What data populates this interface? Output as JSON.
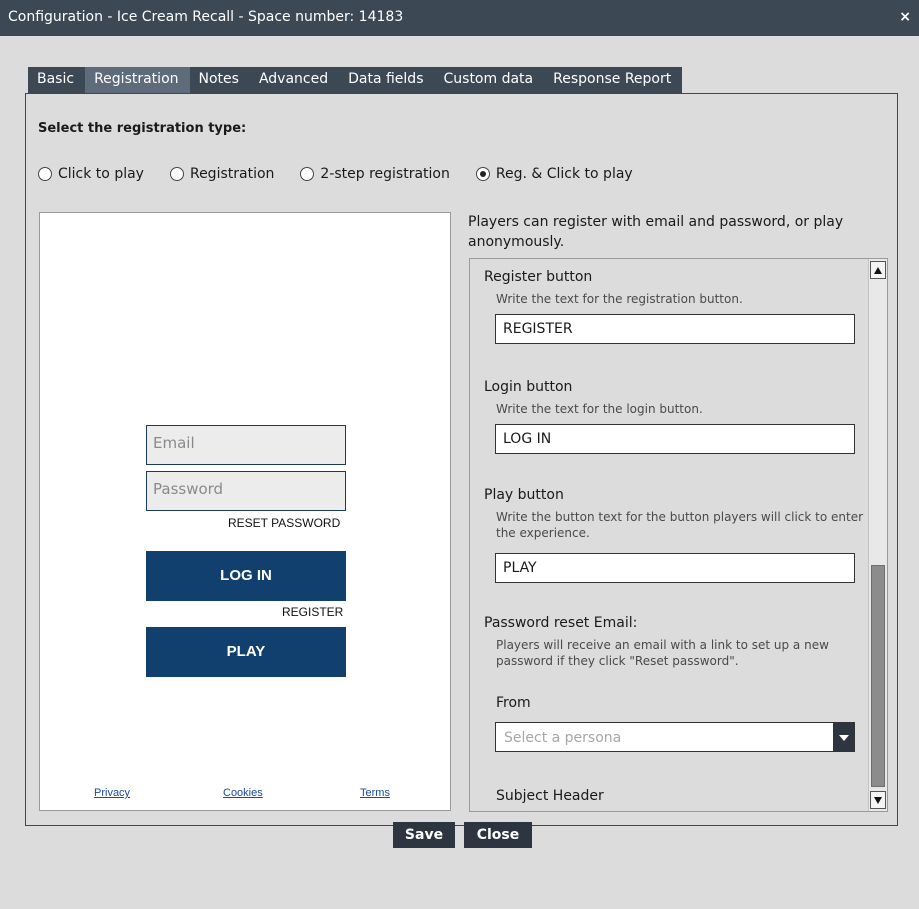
{
  "window": {
    "title": "Configuration - Ice Cream Recall - Space number: 14183",
    "close_glyph": "×"
  },
  "tabs": [
    {
      "label": "Basic",
      "active": false
    },
    {
      "label": "Registration",
      "active": true
    },
    {
      "label": "Notes",
      "active": false
    },
    {
      "label": "Advanced",
      "active": false
    },
    {
      "label": "Data fields",
      "active": false
    },
    {
      "label": "Custom data",
      "active": false
    },
    {
      "label": "Response Report",
      "active": false
    }
  ],
  "registration": {
    "type_label": "Select the registration type:",
    "options": [
      {
        "label": "Click to play",
        "selected": false
      },
      {
        "label": "Registration",
        "selected": false
      },
      {
        "label": "2-step registration",
        "selected": false
      },
      {
        "label": "Reg. & Click to play",
        "selected": true
      }
    ],
    "description": "Players can register with email and password, or play anonymously."
  },
  "preview": {
    "email_placeholder": "Email",
    "password_placeholder": "Password",
    "reset_password": "RESET PASSWORD",
    "login_button": "LOG IN",
    "register_link": "REGISTER",
    "play_button": "PLAY",
    "footer": {
      "privacy": "Privacy",
      "cookies": "Cookies",
      "terms": "Terms"
    },
    "button_color": "#113f6e"
  },
  "settings": {
    "register_button": {
      "title": "Register button",
      "help": "Write the text for the registration button.",
      "value": "REGISTER"
    },
    "login_button": {
      "title": "Login button",
      "help": "Write the text for the login button.",
      "value": "LOG IN"
    },
    "play_button": {
      "title": "Play button",
      "help": "Write the button text for the button players will click to enter the experience.",
      "value": "PLAY"
    },
    "password_reset": {
      "title": "Password reset Email:",
      "help": "Players will receive an email with a link to set up a new password if they click \"Reset password\".",
      "from_label": "From",
      "from_placeholder": "Select a persona",
      "subject_label": "Subject Header"
    }
  },
  "footer_buttons": {
    "save": "Save",
    "close": "Close"
  }
}
